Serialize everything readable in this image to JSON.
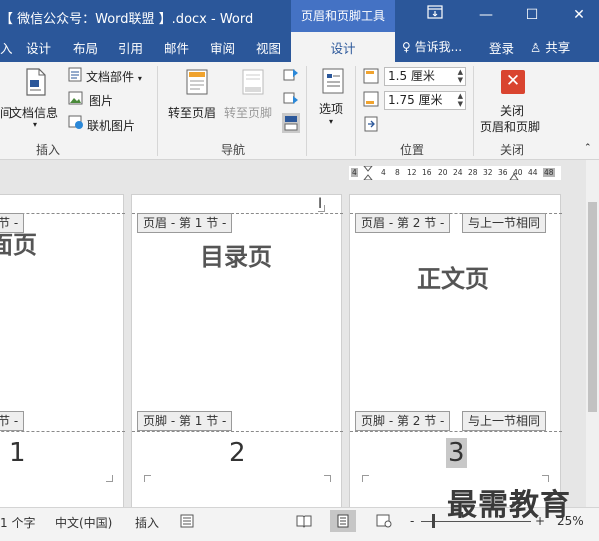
{
  "titlebar": {
    "title": "【 微信公众号：Word联盟 】.docx - Word",
    "context_tab": "页眉和页脚工具",
    "restore_icon": "ribbon-display-icon",
    "minimize": "—",
    "maximize": "☐",
    "close": "✕"
  },
  "tabs": {
    "items": [
      "设计",
      "布局",
      "引用",
      "邮件",
      "审阅",
      "视图"
    ],
    "partial_first": "入",
    "active": "设计",
    "tell_me": "告诉我...",
    "login": "登录",
    "share": "共享"
  },
  "ribbon": {
    "doc_info": "文档信息",
    "doc_parts": "文档部件",
    "picture": "图片",
    "online_picture": "联机图片",
    "partial_left": "间",
    "insert_group": "插入",
    "goto_header": "转至页眉",
    "goto_footer": "转至页脚",
    "nav_group": "导航",
    "options": "选项",
    "header_pos": "1.5 厘米",
    "footer_pos": "1.75 厘米",
    "position_group": "位置",
    "close_line1": "关闭",
    "close_line2": "页眉和页脚",
    "close_group": "关闭"
  },
  "ruler": {
    "ticks": [
      "4",
      "4",
      "8",
      "12",
      "16",
      "20",
      "24",
      "28",
      "32",
      "36",
      "40",
      "44",
      "48"
    ]
  },
  "pages": [
    {
      "header_tag": "节 -",
      "title": "封面页",
      "footer_tag": "节 -",
      "number": "1"
    },
    {
      "header_tag": "页眉 - 第 1 节 -",
      "title": "目录页",
      "footer_tag": "页脚 - 第 1 节 -",
      "number": "2"
    },
    {
      "header_tag": "页眉 - 第 2 节 -",
      "header_link": "与上一节相同",
      "title": "正文页",
      "footer_tag": "页脚 - 第 2 节 -",
      "footer_link": "与上一节相同",
      "number": "3"
    }
  ],
  "status": {
    "word_count": "1 个字",
    "language": "中文(中国)",
    "insert_mode": "插入",
    "zoom": "25%",
    "zoom_minus": "-",
    "zoom_plus": "+"
  },
  "watermark": "最需教育"
}
